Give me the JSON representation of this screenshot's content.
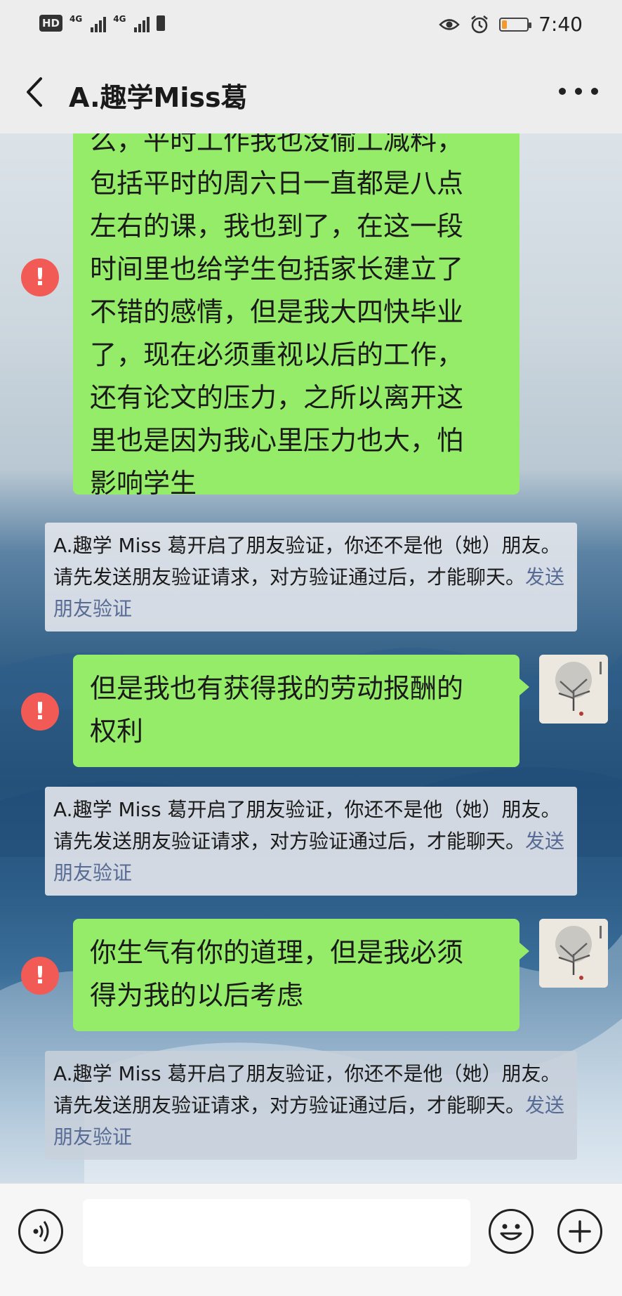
{
  "status_bar": {
    "hd_label": "HD",
    "signal1_label": "4G",
    "signal2_label": "4G",
    "time": "7:40",
    "battery_level": 0.2,
    "battery_color": "#f29a2e"
  },
  "header": {
    "back_icon": "chevron-left-icon",
    "title": "A.趣学Miss葛",
    "more_icon": "more-horizontal-icon"
  },
  "messages": [
    {
      "type": "sent",
      "status": "failed",
      "text": "么，平时工作我也没偷工减料，\n包括平时的周六日一直都是八点\n左右的课，我也到了，在这一段\n时间里也给学生包括家长建立了\n不错的感情，但是我大四快毕业\n了，现在必须重视以后的工作，\n还有论文的压力，之所以离开这\n里也是因为我心里压力也大，怕\n影响学生"
    },
    {
      "type": "system",
      "text": "A.趣学 Miss 葛开启了朋友验证，你还不是他（她）朋友。请先发送朋友验证请求，对方验证通过后，才能聊天。",
      "link": "发送朋友验证"
    },
    {
      "type": "sent",
      "status": "failed",
      "text": "但是我也有获得我的劳动报酬的\n权利"
    },
    {
      "type": "system",
      "text": "A.趣学 Miss 葛开启了朋友验证，你还不是他（她）朋友。请先发送朋友验证请求，对方验证通过后，才能聊天。",
      "link": "发送朋友验证"
    },
    {
      "type": "sent",
      "status": "failed",
      "text": "你生气有你的道理，但是我必须\n得为我的以后考虑"
    },
    {
      "type": "system",
      "text": "A.趣学 Miss 葛开启了朋友验证，你还不是他（她）朋友。请先发送朋友验证请求，对方验证通过后，才能聊天。",
      "link": "发送朋友验证"
    }
  ],
  "error_icon_glyph": "!",
  "bottom_bar": {
    "voice_icon": "voice-icon",
    "input_value": "",
    "emoji_icon": "emoji-icon",
    "plus_icon": "plus-icon"
  },
  "colors": {
    "bubble_sent": "#95ec69",
    "error": "#f25a56",
    "link": "#576b95"
  }
}
